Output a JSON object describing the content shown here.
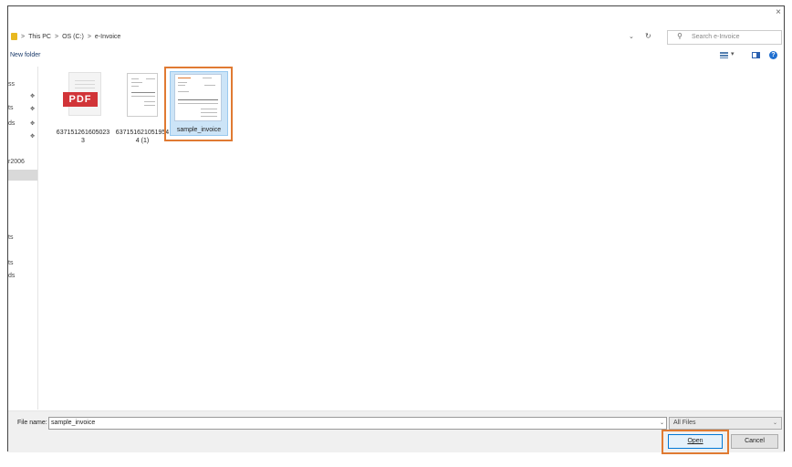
{
  "window": {
    "close_glyph": "×"
  },
  "address_bar": {
    "breadcrumb": [
      "This PC",
      "OS (C:)",
      "e-Invoice"
    ],
    "separator": ">",
    "dropdown_glyph": "⌄",
    "refresh_glyph": "↻"
  },
  "search": {
    "placeholder": "Search e-Invoice"
  },
  "toolbar": {
    "new_folder_label": "New folder",
    "help_glyph": "?",
    "view_dd_glyph": "▾"
  },
  "nav_pane": {
    "items": [
      {
        "text": "ss",
        "pinned": false
      },
      {
        "text": "ts",
        "pinned": true
      },
      {
        "text": "ds",
        "pinned": true
      },
      {
        "text": "",
        "pinned": true
      },
      {
        "text": "r2006",
        "pinned": false
      },
      {
        "text": "ts",
        "pinned": false
      },
      {
        "text": "ts",
        "pinned": false
      },
      {
        "text": "ds",
        "pinned": false
      }
    ],
    "pin_glyph": "📌"
  },
  "files": [
    {
      "name_line1": "637151261605023",
      "name_line2": "3",
      "type": "pdf",
      "badge": "PDF"
    },
    {
      "name_line1": "637151621051954",
      "name_line2": "4 (1)",
      "type": "invoice-image"
    },
    {
      "name": "sample_invoice",
      "type": "invoice-image",
      "selected": true
    }
  ],
  "bottom": {
    "file_name_label": "File name:",
    "file_name_value": "sample_invoice",
    "filter_value": "All Files",
    "open_label": "Open",
    "cancel_label": "Cancel",
    "dd_glyph": "⌄"
  },
  "colors": {
    "highlight": "#e07a32",
    "selection": "#cce4f7",
    "pdf_red": "#d13438",
    "folder": "#e8b820"
  }
}
